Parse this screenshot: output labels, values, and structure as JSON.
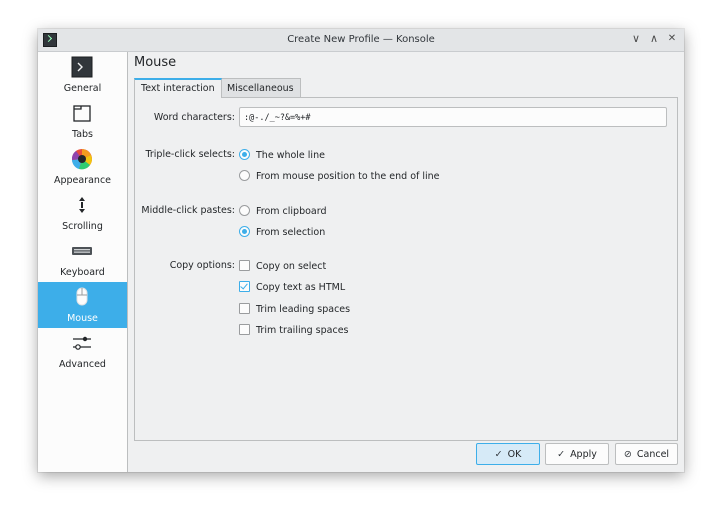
{
  "window": {
    "title": "Create New Profile — Konsole",
    "controls": {
      "minimize": "∨",
      "maximize": "∧",
      "close": "✕"
    }
  },
  "sidebar": {
    "items": [
      {
        "label": "General",
        "icon": "terminal-icon"
      },
      {
        "label": "Tabs",
        "icon": "tabs-icon"
      },
      {
        "label": "Appearance",
        "icon": "color-wheel-icon"
      },
      {
        "label": "Scrolling",
        "icon": "scroll-icon"
      },
      {
        "label": "Keyboard",
        "icon": "keyboard-icon"
      },
      {
        "label": "Mouse",
        "icon": "mouse-icon",
        "active": true
      },
      {
        "label": "Advanced",
        "icon": "sliders-icon"
      }
    ]
  },
  "page": {
    "title": "Mouse",
    "tabs": [
      {
        "label": "Text interaction",
        "active": true
      },
      {
        "label": "Miscellaneous",
        "active": false
      }
    ]
  },
  "form": {
    "word_characters": {
      "label": "Word characters:",
      "value": ":@-./_~?&=%+#"
    },
    "triple_click": {
      "label": "Triple-click selects:",
      "options": [
        {
          "label": "The whole line",
          "checked": true
        },
        {
          "label": "From mouse position to the end of line",
          "checked": false
        }
      ]
    },
    "middle_click": {
      "label": "Middle-click pastes:",
      "options": [
        {
          "label": "From clipboard",
          "checked": false
        },
        {
          "label": "From selection",
          "checked": true
        }
      ]
    },
    "copy_options": {
      "label": "Copy options:",
      "options": [
        {
          "label": "Copy on select",
          "checked": false
        },
        {
          "label": "Copy text as HTML",
          "checked": true
        },
        {
          "label": "Trim leading spaces",
          "checked": false
        },
        {
          "label": "Trim trailing spaces",
          "checked": false
        }
      ]
    }
  },
  "buttons": {
    "ok": "OK",
    "apply": "Apply",
    "cancel": "Cancel"
  },
  "colors": {
    "accent": "#3daee9",
    "window_bg": "#eff0f1",
    "sidebar_bg": "#fcfcfc"
  }
}
